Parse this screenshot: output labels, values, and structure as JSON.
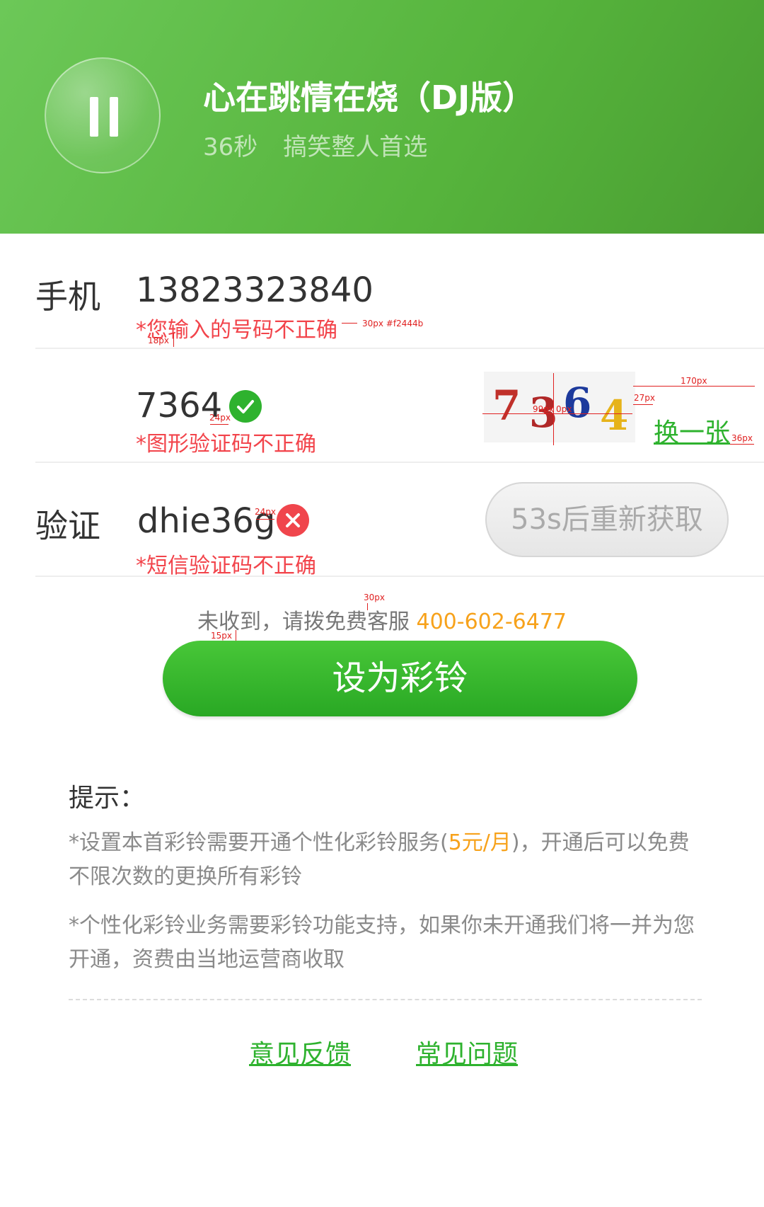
{
  "header": {
    "song_title": "心在跳情在烧（DJ版）",
    "duration": "36秒",
    "tag": "搞笑整人首选",
    "play_state": "paused"
  },
  "form": {
    "phone": {
      "label": "手机",
      "value": "13823323840",
      "error": "*您输入的号码不正确"
    },
    "captcha": {
      "value": "7364",
      "status": "valid",
      "error": "*图形验证码不正确",
      "image_chars": [
        "7",
        "3",
        "6",
        "4"
      ],
      "refresh_label": "换一张"
    },
    "sms": {
      "label": "验证",
      "value": "dhie36g",
      "status": "invalid",
      "error": "*短信验证码不正确",
      "resend_label": "53s后重新获取"
    }
  },
  "annotations": {
    "a1": "30px #f2444b",
    "a2": "18px",
    "a3": "24px",
    "a4": "99px",
    "a5": "0px",
    "a6": "27px",
    "a7": "170px",
    "a8": "36px",
    "a9": "24px",
    "a10": "30px",
    "a11": "15px"
  },
  "hotline": {
    "text": "未收到，请拨免费客服",
    "number": "400-602-6477"
  },
  "submit_label": "设为彩铃",
  "tips": {
    "title": "提示：",
    "line1_a": "*设置本首彩铃需要开通个性化彩铃服务(",
    "line1_price": "5元/月",
    "line1_b": ")，开通后可以免费不限次数的更换所有彩铃",
    "line2": "*个性化彩铃业务需要彩铃功能支持，如果你未开通我们将一并为您开通，资费由当地运营商收取"
  },
  "footer": {
    "feedback": "意见反馈",
    "faq": "常见问题"
  },
  "colors": {
    "brand_green": "#2eb22e",
    "error_red": "#f2444b",
    "accent_orange": "#f7a21b"
  }
}
